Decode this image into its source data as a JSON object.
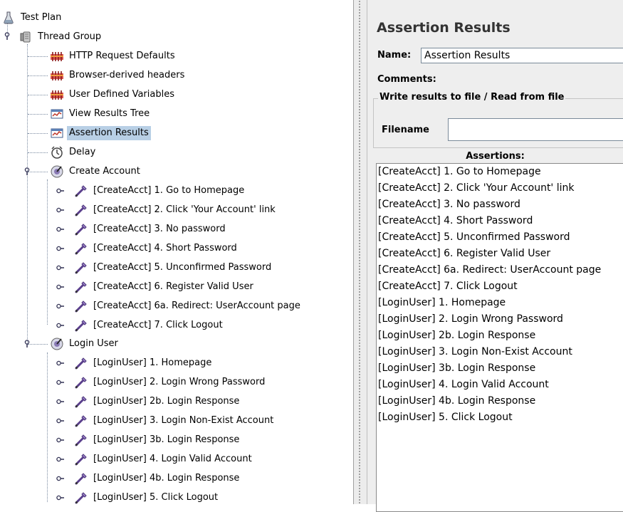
{
  "tree": {
    "root": "Test Plan",
    "thread_group": "Thread Group",
    "items": [
      "HTTP Request Defaults",
      "Browser-derived headers",
      "User Defined Variables",
      "View Results Tree",
      "Assertion Results",
      "Delay"
    ],
    "selected": "Assertion Results",
    "create_account": {
      "label": "Create Account",
      "samplers": [
        "[CreateAcct] 1. Go to Homepage",
        "[CreateAcct] 2. Click 'Your Account' link",
        "[CreateAcct] 3. No password",
        "[CreateAcct] 4. Short Password",
        "[CreateAcct] 5. Unconfirmed Password",
        "[CreateAcct] 6. Register Valid User",
        "[CreateAcct] 6a. Redirect: UserAccount page",
        "[CreateAcct] 7. Click Logout"
      ]
    },
    "login_user": {
      "label": "Login User",
      "samplers": [
        "[LoginUser] 1. Homepage",
        "[LoginUser] 2. Login Wrong Password",
        "[LoginUser] 2b. Login Response",
        "[LoginUser] 3. Login Non-Exist Account",
        "[LoginUser] 3b. Login Response",
        "[LoginUser] 4. Login Valid Account",
        "[LoginUser] 4b. Login Response",
        "[LoginUser] 5. Click Logout"
      ]
    }
  },
  "panel": {
    "title": "Assertion Results",
    "name_label": "Name:",
    "name_value": "Assertion Results",
    "comments_label": "Comments:",
    "file_group_title": "Write results to file / Read from file",
    "filename_label": "Filename",
    "filename_value": "",
    "assertions_label": "Assertions:",
    "assertions": [
      "[CreateAcct] 1. Go to Homepage",
      "[CreateAcct] 2. Click 'Your Account' link",
      "[CreateAcct] 3. No password",
      "[CreateAcct] 4. Short Password",
      "[CreateAcct] 5. Unconfirmed Password",
      "[CreateAcct] 6. Register Valid User",
      "[CreateAcct] 6a. Redirect: UserAccount page",
      "[CreateAcct] 7. Click Logout",
      "[LoginUser] 1. Homepage",
      "[LoginUser] 2. Login Wrong Password",
      "[LoginUser] 2b. Login Response",
      "[LoginUser] 3. Login Non-Exist Account",
      "[LoginUser] 3b. Login Response",
      "[LoginUser] 4. Login Valid Account",
      "[LoginUser] 4b. Login Response",
      "[LoginUser] 5. Click Logout"
    ]
  },
  "colors": {
    "selection": "#b8cfe5",
    "panel_bg": "#eeeeee",
    "config_icon": "#c0392b",
    "sampler_icon": "#6b4fa0"
  }
}
